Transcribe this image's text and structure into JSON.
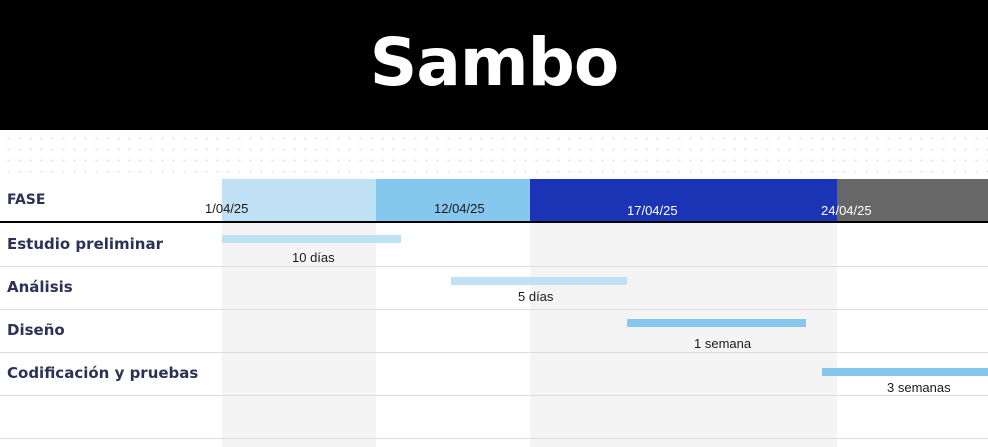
{
  "title": "Sambo",
  "header": {
    "phase_label": "FASE",
    "dates": [
      "1/04/25",
      "12/04/25",
      "17/04/25",
      "24/04/25"
    ]
  },
  "tasks": [
    {
      "name": "Estudio preliminar",
      "duration": "10 días"
    },
    {
      "name": "Análisis",
      "duration": "5 días"
    },
    {
      "name": "Diseño",
      "duration": "1 semana"
    },
    {
      "name": "Codificación y pruebas",
      "duration": "3 semanas"
    }
  ],
  "colors": {
    "banner": "#000000",
    "segment_1": "#bfe0f5",
    "segment_2": "#86c7ee",
    "segment_3": "#1b33b5",
    "segment_4": "#676767",
    "bar_light": "#bfe0f5",
    "bar_medium": "#86c7ee",
    "label_text": "#2b3256"
  }
}
